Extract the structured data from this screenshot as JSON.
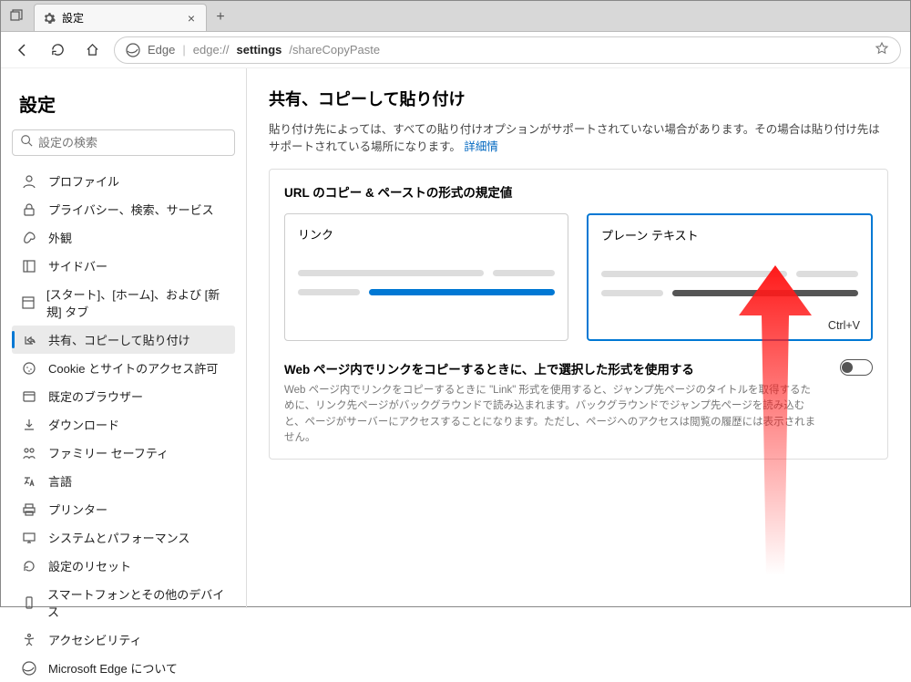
{
  "tab": {
    "title": "設定"
  },
  "addressbar": {
    "browser_label": "Edge",
    "url_prefix": "edge://",
    "url_bold": "settings",
    "url_suffix": "/shareCopyPaste"
  },
  "sidebar": {
    "heading": "設定",
    "search_placeholder": "設定の検索",
    "items": [
      {
        "label": "プロファイル",
        "icon": "profile"
      },
      {
        "label": "プライバシー、検索、サービス",
        "icon": "lock"
      },
      {
        "label": "外観",
        "icon": "appearance"
      },
      {
        "label": "サイドバー",
        "icon": "sidebar"
      },
      {
        "label": "[スタート]、[ホーム]、および [新規] タブ",
        "icon": "start"
      },
      {
        "label": "共有、コピーして貼り付け",
        "icon": "share"
      },
      {
        "label": "Cookie とサイトのアクセス許可",
        "icon": "cookie"
      },
      {
        "label": "既定のブラウザー",
        "icon": "browser"
      },
      {
        "label": "ダウンロード",
        "icon": "download"
      },
      {
        "label": "ファミリー セーフティ",
        "icon": "family"
      },
      {
        "label": "言語",
        "icon": "language"
      },
      {
        "label": "プリンター",
        "icon": "printer"
      },
      {
        "label": "システムとパフォーマンス",
        "icon": "system"
      },
      {
        "label": "設定のリセット",
        "icon": "reset"
      },
      {
        "label": "スマートフォンとその他のデバイス",
        "icon": "phone"
      },
      {
        "label": "アクセシビリティ",
        "icon": "accessibility"
      },
      {
        "label": "Microsoft Edge について",
        "icon": "about"
      }
    ],
    "active_index": 5
  },
  "content": {
    "heading": "共有、コピーして貼り付け",
    "description": "貼り付け先によっては、すべての貼り付けオプションがサポートされていない場合があります。その場合は貼り付け先はサポートされている場所になります。",
    "details_link": "詳細情",
    "format_section_title": "URL のコピー & ペーストの形式の規定値",
    "card_link": {
      "title": "リンク"
    },
    "card_plain": {
      "title": "プレーン テキスト",
      "shortcut": "Ctrl+V"
    },
    "sub_title": "Web ページ内でリンクをコピーするときに、上で選択した形式を使用する",
    "sub_desc": "Web ページ内でリンクをコピーするときに \"Link\" 形式を使用すると、ジャンプ先ページのタイトルを取得するために、リンク先ページがバックグラウンドで読み込まれます。バックグラウンドでジャンプ先ページを読み込むと、ページがサーバーにアクセスすることになります。ただし、ページへのアクセスは閲覧の履歴には表示されません。"
  }
}
